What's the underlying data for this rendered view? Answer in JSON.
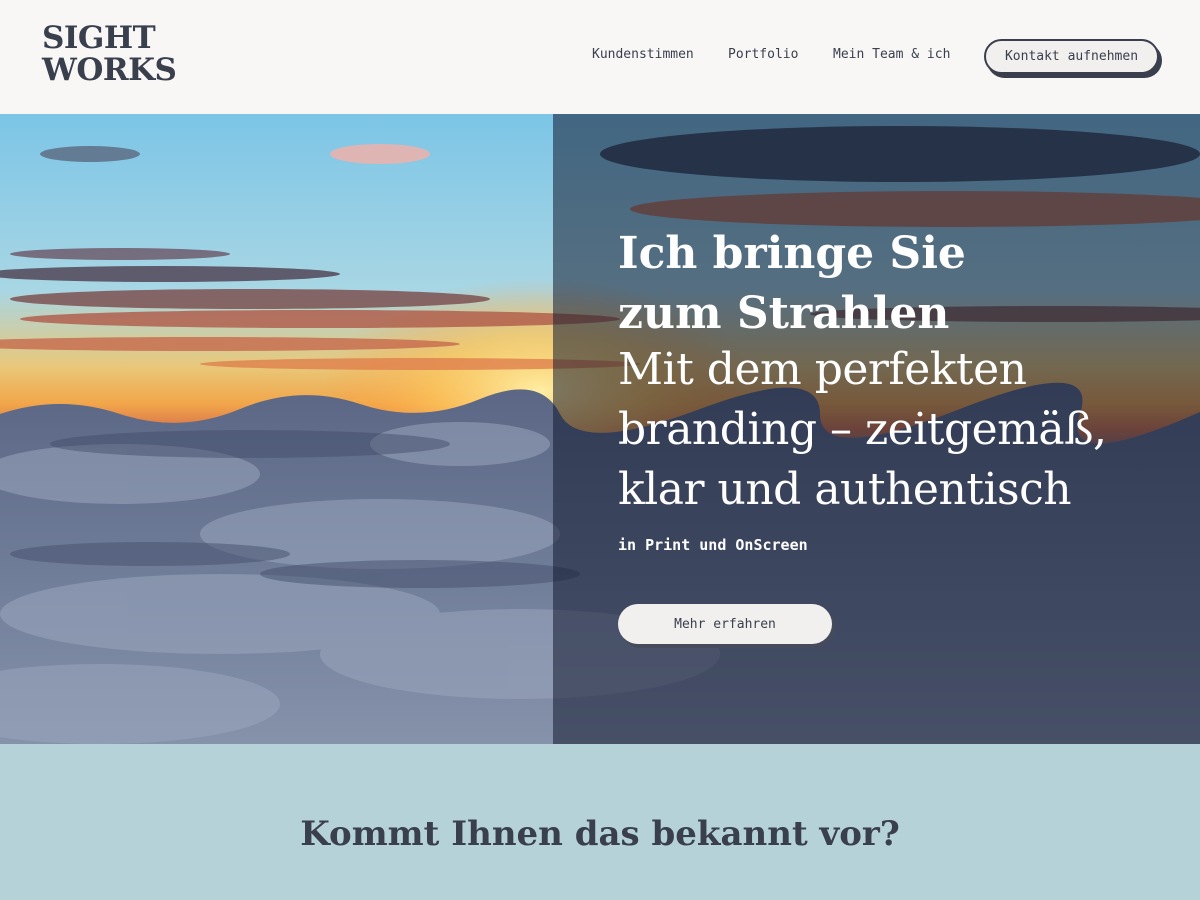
{
  "header": {
    "logo_line1": "SIGHT",
    "logo_line2": "WORKS",
    "nav": [
      "Kundenstimmen",
      "Portfolio",
      "Mein Team & ich"
    ],
    "contact_label": "Kontakt aufnehmen"
  },
  "hero": {
    "title_line1": "Ich bringe Sie",
    "title_line2": "zum Strahlen",
    "sub_line1": "Mit dem perfekten",
    "sub_line2": "branding – zeitgemäß,",
    "sub_line3": "klar und authentisch",
    "tagline": "in Print und OnScreen",
    "button_label": "Mehr erfahren"
  },
  "section": {
    "title": "Kommt Ihnen das bekannt vor?"
  },
  "colors": {
    "text": "#3a3f4e",
    "header_bg": "#f8f7f5",
    "section_bg": "#b5d2d8",
    "overlay": "#121a30"
  }
}
